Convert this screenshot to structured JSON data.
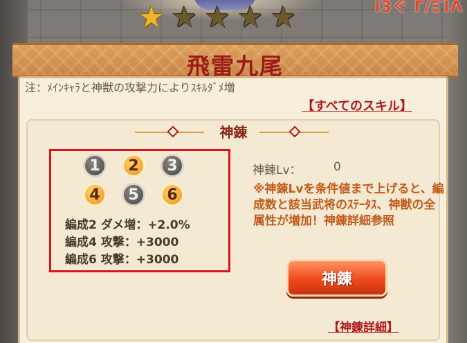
{
  "top_right_text": "Ι3ぐ Γ/ΞΊΛ",
  "stars": {
    "filled": 1,
    "total": 5
  },
  "title": "飛雷九尾",
  "skill_description": "注：ﾒｲﾝｷｬﾗと神獣の攻撃力によりｽｷﾙﾀﾞﾒ増",
  "all_skills_link": "【すべてのスキル】",
  "section_title": "神錬",
  "formation_slots": [
    {
      "label": "1",
      "active": false
    },
    {
      "label": "2",
      "active": true
    },
    {
      "label": "3",
      "active": false
    },
    {
      "label": "4",
      "active": true
    },
    {
      "label": "5",
      "active": false
    },
    {
      "label": "6",
      "active": true
    }
  ],
  "bonuses": [
    "編成2 ダメ増：+2.0%",
    "編成4 攻撃：+3000",
    "編成6 攻撃：+3000"
  ],
  "lv_label": "神錬Lv：",
  "lv_value": "0",
  "notice": "※神錬Lvを条件値まで上げると、編成数と該当武将のｽﾃｰﾀｽ、神獣の全属性が増加！神錬詳細参照",
  "shinren_button": "神錬",
  "detail_link": "【神錬詳細】",
  "colors": {
    "accent_red": "#d8151c",
    "gold": "#f08e1c",
    "panel": "#f7efdc"
  }
}
